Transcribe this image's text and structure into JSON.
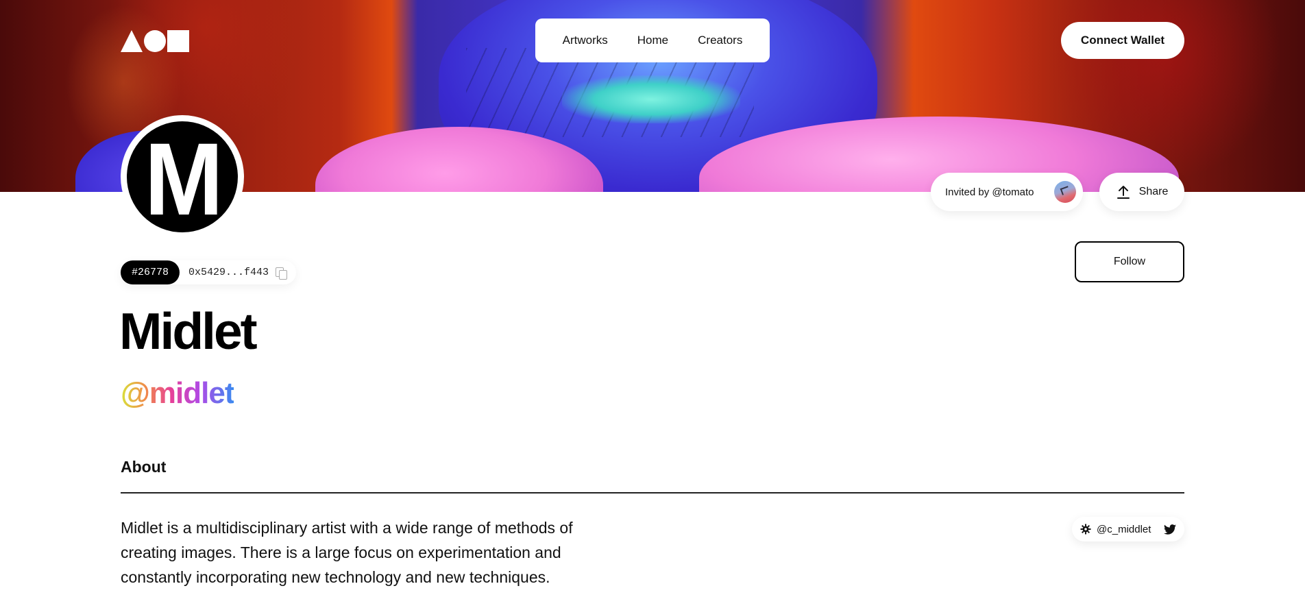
{
  "header": {
    "logo": "shapes-logo",
    "nav": [
      {
        "label": "Artworks"
      },
      {
        "label": "Home"
      },
      {
        "label": "Creators"
      }
    ],
    "connect_label": "Connect Wallet"
  },
  "profile": {
    "avatar_letter": "M",
    "token_id": "#26778",
    "address": "0x5429...f443",
    "name": "Midlet",
    "handle": "@midlet",
    "invited_label": "Invited by @tomato",
    "share_label": "Share",
    "follow_label": "Follow"
  },
  "about": {
    "heading": "About",
    "bio": "Midlet is a multidisciplinary artist with a wide range of methods of creating images. There is a large focus on experimentation and constantly incorporating new technology and new techniques.",
    "social_handle": "@c_middlet",
    "social_icons": [
      "gear-icon",
      "twitter-icon"
    ]
  },
  "colors": {
    "text": "#000000",
    "background": "#ffffff",
    "handle_gradient": [
      "#d8e23a",
      "#f08a4a",
      "#e6409a",
      "#b04ae6",
      "#3a8af0"
    ]
  }
}
